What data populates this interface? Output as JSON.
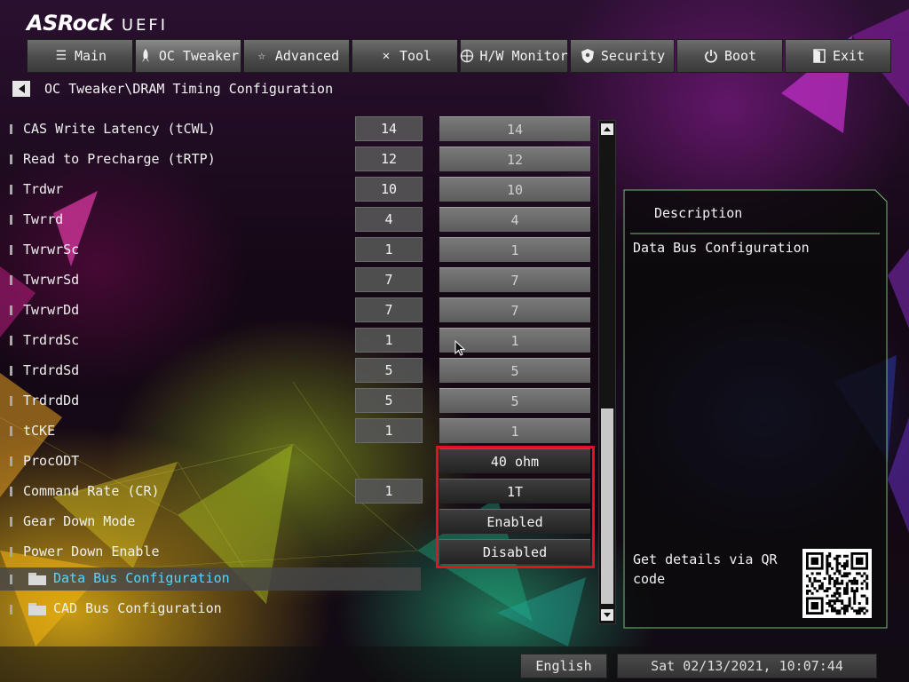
{
  "brand": {
    "name": "ASRock",
    "product": "UEFI"
  },
  "tabs": [
    {
      "label": "Main",
      "icon": "list-icon"
    },
    {
      "label": "OC Tweaker",
      "icon": "rocket-icon",
      "active": true
    },
    {
      "label": "Advanced",
      "icon": "star-icon"
    },
    {
      "label": "Tool",
      "icon": "tools-icon"
    },
    {
      "label": "H/W Monitor",
      "icon": "monitor-icon"
    },
    {
      "label": "Security",
      "icon": "shield-icon"
    },
    {
      "label": "Boot",
      "icon": "power-icon"
    },
    {
      "label": "Exit",
      "icon": "exit-door-icon"
    }
  ],
  "breadcrumb": "OC Tweaker\\DRAM Timing Configuration",
  "settings": [
    {
      "label": "CAS Write Latency (tCWL)",
      "current": "14",
      "value": "14"
    },
    {
      "label": "Read to Precharge (tRTP)",
      "current": "12",
      "value": "12"
    },
    {
      "label": "Trdwr",
      "current": "10",
      "value": "10"
    },
    {
      "label": "Twrrd",
      "current": "4",
      "value": "4"
    },
    {
      "label": "TwrwrSc",
      "current": "1",
      "value": "1"
    },
    {
      "label": "TwrwrSd",
      "current": "7",
      "value": "7"
    },
    {
      "label": "TwrwrDd",
      "current": "7",
      "value": "7"
    },
    {
      "label": "TrdrdSc",
      "current": "1",
      "value": "1"
    },
    {
      "label": "TrdrdSd",
      "current": "5",
      "value": "5"
    },
    {
      "label": "TrdrdDd",
      "current": "5",
      "value": "5"
    },
    {
      "label": "tCKE",
      "current": "1",
      "value": "1"
    },
    {
      "label": "ProcODT",
      "current": "",
      "value": "40 ohm"
    },
    {
      "label": "Command Rate (CR)",
      "current": "1",
      "value": "1T"
    },
    {
      "label": "Gear Down Mode",
      "current": "",
      "value": "Enabled"
    },
    {
      "label": "Power Down Enable",
      "current": "",
      "value": "Disabled"
    }
  ],
  "submenus": [
    {
      "label": "Data Bus Configuration",
      "selected": true
    },
    {
      "label": "CAD Bus Configuration",
      "selected": false
    }
  ],
  "description": {
    "title": "Description",
    "text": "Data Bus Configuration",
    "qr_text": "Get details via QR code"
  },
  "footer": {
    "language": "English",
    "datetime": "Sat 02/13/2021, 10:07:44"
  },
  "colors": {
    "highlight": "#53d6ff",
    "redbox": "#e0141d",
    "accent_line": "#6fbf6f"
  }
}
